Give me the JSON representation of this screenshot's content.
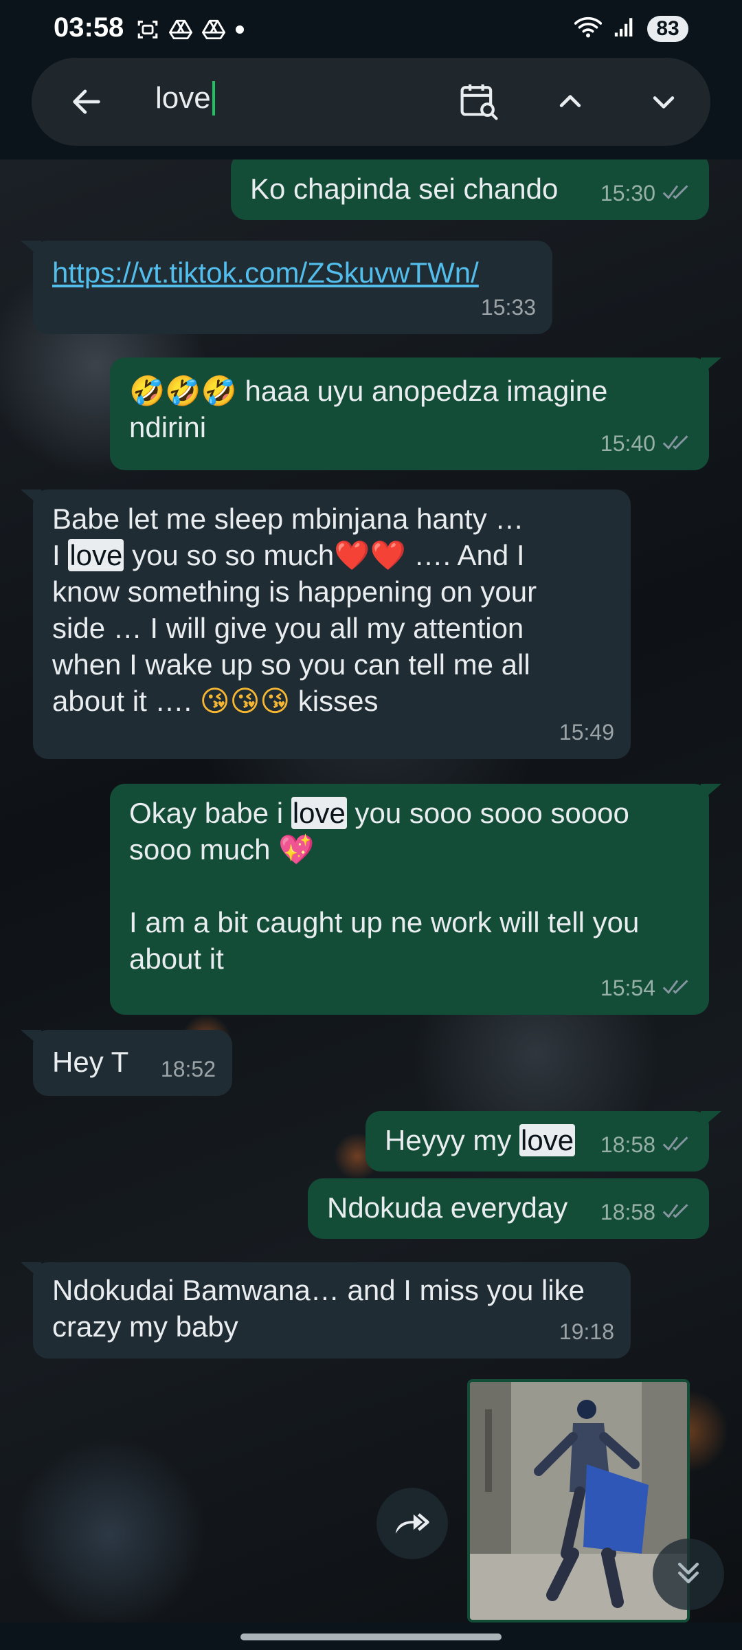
{
  "status_bar": {
    "time": "03:58",
    "battery": "83",
    "left_icons": [
      "screenshot-icon",
      "drive-icon",
      "drive-icon",
      "dot-icon"
    ],
    "right_icons": [
      "wifi-icon",
      "signal-icon"
    ]
  },
  "search": {
    "query": "love",
    "icons": [
      "back-arrow-icon",
      "calendar-search-icon",
      "chevron-up-icon",
      "chevron-down-icon"
    ]
  },
  "messages": [
    {
      "dir": "out",
      "text": "Ko chapinda sei chando",
      "time": "15:30",
      "ticks": "read"
    },
    {
      "dir": "in",
      "link": "https://vt.tiktok.com/ZSkuvwTWn/",
      "time": "15:33"
    },
    {
      "dir": "out",
      "emoji": "🤣🤣🤣",
      "text": " haaa uyu anopedza imagine",
      "text2": "ndirini",
      "time": "15:40",
      "ticks": "read"
    },
    {
      "dir": "in",
      "line1": "Babe let me sleep mbinjana hanty …",
      "pre": "I ",
      "highlight": "love",
      "post": " you so so much",
      "emoji": "❤️❤️",
      "post2": " …. And I",
      "line3": "know something is happening on your",
      "line4": "side … I will give you all my attention",
      "line5": "when I wake up so you can tell me all",
      "line6a": "about it …. ",
      "emoji2": "😘😘😘",
      "line6b": " kisses",
      "time": "15:49"
    },
    {
      "dir": "out",
      "pre": "Okay babe i ",
      "highlight": "love",
      "post": " you sooo sooo soooo",
      "line2": "sooo much ",
      "emoji": "💖",
      "line3": "I am a bit caught up ne work will tell you",
      "line4": "about it",
      "time": "15:54",
      "ticks": "read"
    },
    {
      "dir": "in",
      "text": "Hey T",
      "time": "18:52"
    },
    {
      "dir": "out",
      "pre": "Heyyy my ",
      "highlight": "love",
      "time": "18:58",
      "ticks": "read"
    },
    {
      "dir": "out",
      "text": "Ndokuda everyday",
      "time": "18:58",
      "ticks": "read"
    },
    {
      "dir": "in",
      "line1": "Ndokudai Bamwana… and I miss you like",
      "line2": "crazy my baby",
      "time": "19:18"
    }
  ],
  "video": {
    "type": "video-thumbnail"
  },
  "buttons": {
    "forward_icon": "forward-icon",
    "scroll_down_icon": "double-chevron-down-icon"
  },
  "colors": {
    "incoming": "#1f2c33",
    "outgoing": "#134d37",
    "accent": "#21c063",
    "link": "#53bdeb",
    "read_ticks": "#8696a0"
  }
}
